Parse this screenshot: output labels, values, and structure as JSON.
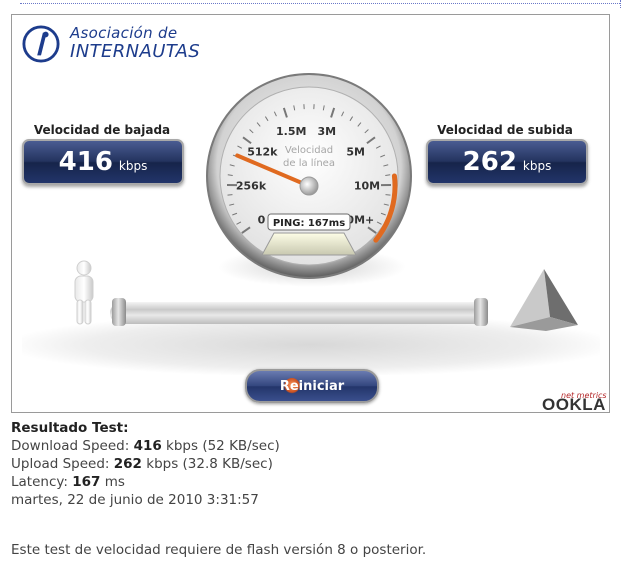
{
  "logo": {
    "line1": "Asociación de",
    "line2": "INTERNAUTAS"
  },
  "download": {
    "title": "Velocidad de bajada",
    "value": "416",
    "unit": "kbps"
  },
  "upload": {
    "title": "Velocidad de subida",
    "value": "262",
    "unit": "kbps"
  },
  "gauge": {
    "center_label_line1": "Velocidad",
    "center_label_line2": "de la línea",
    "ticks": [
      "0",
      "256k",
      "512k",
      "1.5M",
      "3M",
      "5M",
      "10M",
      "20M+"
    ],
    "needle_value_kbps": 416,
    "ping_label": "PING: 167ms",
    "accent_color": "#e06a20"
  },
  "restart_button": {
    "label": "Reiniciar"
  },
  "branding": {
    "small": "net metrics",
    "name": "OOKLA"
  },
  "results": {
    "title": "Resultado Test:",
    "download_label": "Download Speed:",
    "download_value": "416",
    "download_rest": "kbps (52 KB/sec)",
    "upload_label": "Upload Speed:",
    "upload_value": "262",
    "upload_rest": "kbps (32.8 KB/sec)",
    "latency_label": "Latency:",
    "latency_value": "167",
    "latency_rest": "ms",
    "datetime": "martes, 22 de junio de 2010 3:31:57"
  },
  "note": "Este test de velocidad requiere de flash versión 8 o posterior."
}
